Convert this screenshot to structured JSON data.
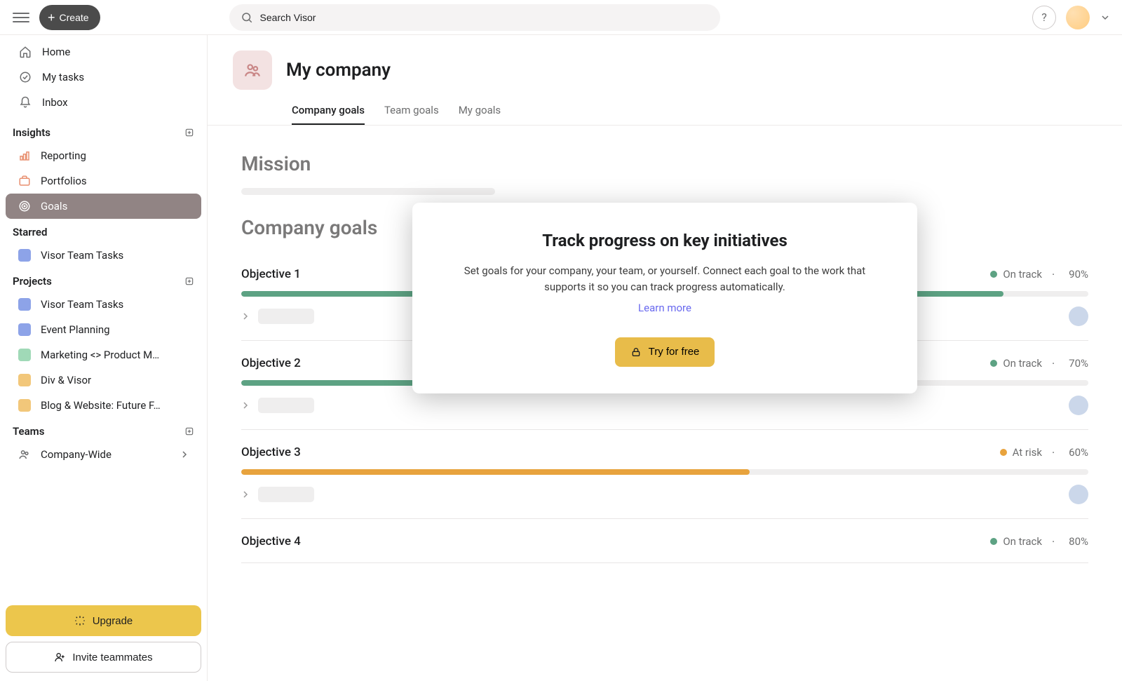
{
  "topbar": {
    "create_label": "Create",
    "search_value": "Search Visor"
  },
  "sidebar": {
    "nav": [
      {
        "label": "Home"
      },
      {
        "label": "My tasks"
      },
      {
        "label": "Inbox"
      }
    ],
    "insights": {
      "header": "Insights",
      "items": [
        {
          "label": "Reporting",
          "color": "#f08f6f"
        },
        {
          "label": "Portfolios",
          "color": "#f08f6f"
        },
        {
          "label": "Goals",
          "color": "#f08f6f",
          "active": true
        }
      ]
    },
    "starred": {
      "header": "Starred",
      "items": [
        {
          "label": "Visor Team Tasks",
          "color": "#8da3e8"
        }
      ]
    },
    "projects": {
      "header": "Projects",
      "items": [
        {
          "label": "Visor Team Tasks",
          "color": "#8da3e8"
        },
        {
          "label": "Event Planning",
          "color": "#8da3e8"
        },
        {
          "label": "Marketing <> Product M…",
          "color": "#a0d9b7"
        },
        {
          "label": "Div & Visor",
          "color": "#f2c77a"
        },
        {
          "label": "Blog & Website: Future F…",
          "color": "#f2c77a"
        }
      ]
    },
    "teams": {
      "header": "Teams",
      "items": [
        {
          "label": "Company-Wide"
        }
      ]
    },
    "upgrade_label": "Upgrade",
    "invite_label": "Invite teammates"
  },
  "header": {
    "title": "My company",
    "tabs": [
      {
        "label": "Company goals",
        "active": true
      },
      {
        "label": "Team goals"
      },
      {
        "label": "My goals"
      }
    ]
  },
  "mission_heading": "Mission",
  "company_goals_heading": "Company goals",
  "goals": [
    {
      "name": "Objective 1",
      "status": "On track",
      "status_color": "green",
      "pct": "90%",
      "pct_num": 90
    },
    {
      "name": "Objective 2",
      "status": "On track",
      "status_color": "green",
      "pct": "70%",
      "pct_num": 70
    },
    {
      "name": "Objective 3",
      "status": "At risk",
      "status_color": "yellow",
      "pct": "60%",
      "pct_num": 60
    },
    {
      "name": "Objective 4",
      "status": "On track",
      "status_color": "green",
      "pct": "80%",
      "pct_num": 80
    }
  ],
  "modal": {
    "title": "Track progress on key initiatives",
    "body": "Set goals for your company, your team, or yourself. Connect each goal to the work that supports it so you can track progress automatically.",
    "learn_more": "Learn more",
    "cta": "Try for free"
  }
}
